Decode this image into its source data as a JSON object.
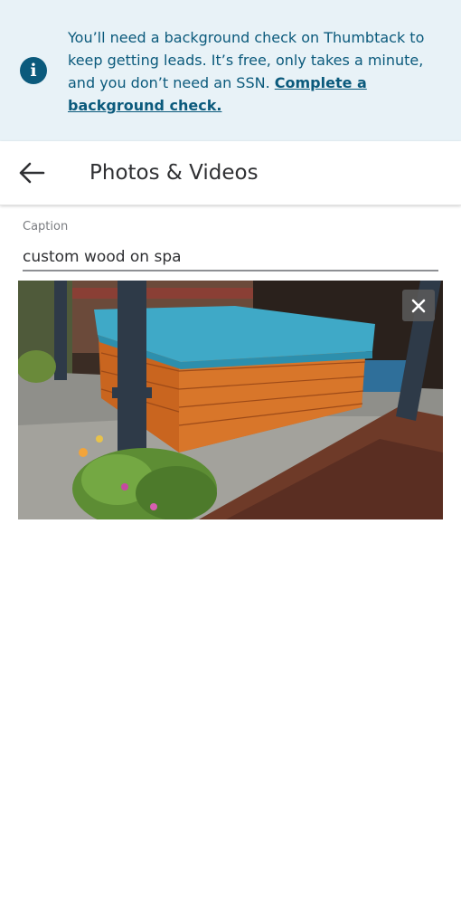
{
  "banner": {
    "icon": "info-icon",
    "icon_glyph": "i",
    "text": "You’ll need a background check on Thumbtack to keep getting leads. It’s free, only takes a minute, and you don’t need an SSN. ",
    "link_label": "Complete a background check.",
    "color": "#0b5a7c",
    "background": "#e8f2f7"
  },
  "header": {
    "back_icon": "back-arrow-icon",
    "title": "Photos & Videos"
  },
  "caption": {
    "label": "Caption",
    "value": "custom wood on spa"
  },
  "media": {
    "subject": "wooden hot tub with teal cover",
    "remove_icon": "close-icon"
  }
}
